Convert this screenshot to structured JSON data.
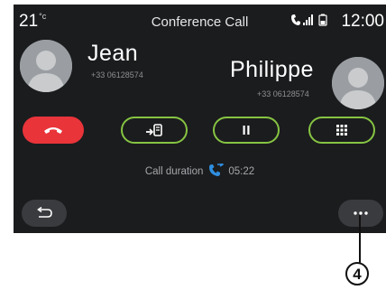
{
  "status_bar": {
    "temperature": "21",
    "temperature_unit": "°c",
    "title": "Conference Call",
    "time": "12:00",
    "icons": [
      "bluetooth-phone-icon",
      "signal-icon",
      "battery-icon"
    ]
  },
  "participants": [
    {
      "name": "Jean",
      "number": "+33 06128574"
    },
    {
      "name": "Philippe",
      "number": "+33 06128574"
    }
  ],
  "controls": {
    "end_call": "end-call-icon",
    "transfer": "transfer-to-phone-icon",
    "hold": "pause-icon",
    "keypad": "keypad-icon"
  },
  "call": {
    "duration_label": "Call duration",
    "duration": "05:22"
  },
  "footer": {
    "back": "back-icon",
    "more": "more-options-icon"
  },
  "annotation": {
    "callout_number": "4"
  },
  "colors": {
    "screen_background": "#1b1c1e",
    "end_call_red": "#e9343a",
    "accent_green": "#86c442",
    "accent_blue": "#2f8fe0",
    "button_grey": "#3a3b3e"
  }
}
